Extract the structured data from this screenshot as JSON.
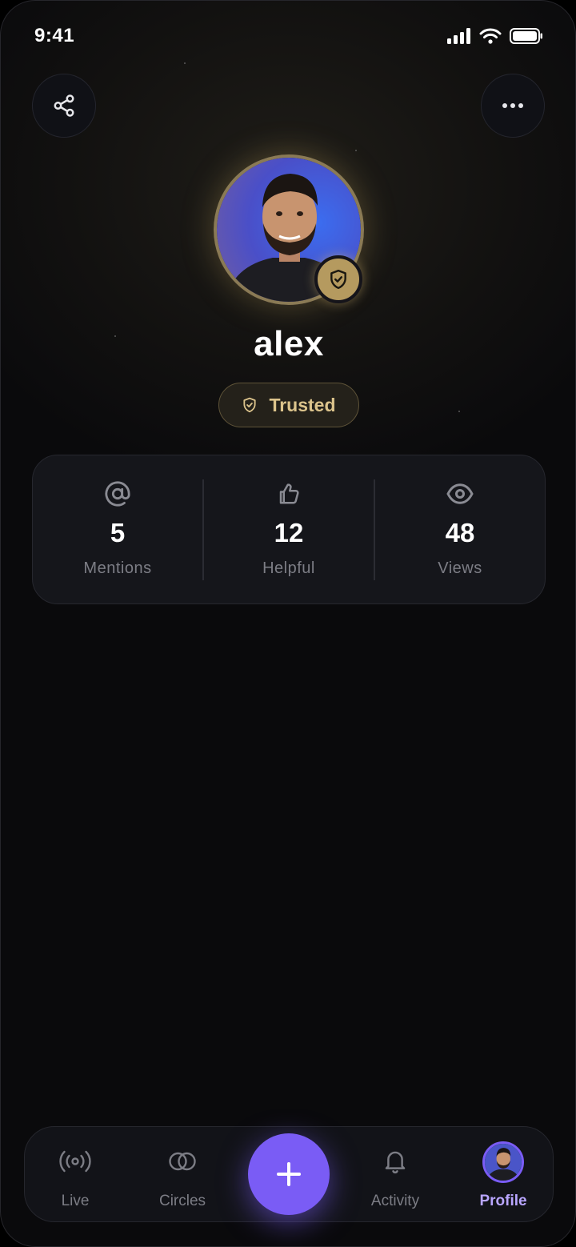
{
  "status_bar": {
    "time": "9:41"
  },
  "header": {
    "share_icon": "share-icon",
    "more_icon": "more-horizontal-icon"
  },
  "profile": {
    "username": "alex",
    "badge": {
      "label": "Trusted",
      "icon": "shield-check-icon"
    }
  },
  "stats": [
    {
      "icon": "at-sign-icon",
      "value": "5",
      "label": "Mentions"
    },
    {
      "icon": "thumbs-up-icon",
      "value": "12",
      "label": "Helpful"
    },
    {
      "icon": "eye-icon",
      "value": "48",
      "label": "Views"
    }
  ],
  "tab_bar": {
    "tabs": [
      {
        "icon": "broadcast-icon",
        "label": "Live"
      },
      {
        "icon": "circles-icon",
        "label": "Circles"
      },
      {
        "icon": "bell-icon",
        "label": "Activity"
      },
      {
        "icon": "avatar",
        "label": "Profile",
        "active": true
      }
    ],
    "fab_icon": "plus-icon"
  },
  "colors": {
    "accent": "#7a5cf5",
    "gold": "#dcc48c",
    "background": "#0a0a0c",
    "card": "#15161b",
    "muted_text": "#7c7d85"
  }
}
